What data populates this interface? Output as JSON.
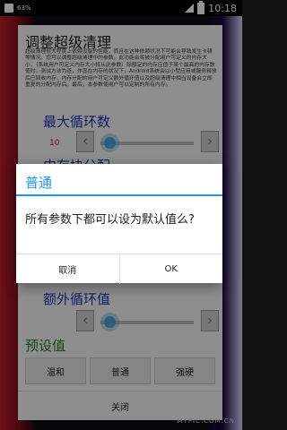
{
  "status_bar": {
    "battery_pct": "63%",
    "time": "10:18"
  },
  "app": {
    "title": "调整超级清理",
    "description": "超级清理很大程度上依赖设备的性能，而且在这种依赖状况下可能会导致发生卡顿等情况。您可以调整超级清理中的参数，此功能会将被分配用户可定义的内存大小，（系统用户可定义内存大小将从此参数）除额定的内存应值于某个最高的内存数值时，测试方法为逐，作显在内存的状况下，Android系统会以小型应用或服务释放后已回收内存，内存分配的用户可定义额外循环值以及超级清理中相当设备会立即重复的分配内存后。最后，本参数使用户可以定制的所有内存。",
    "sections": {
      "max_loop": {
        "title": "最大循环数",
        "value": "10"
      },
      "memory_alloc": {
        "title": "内存块分配"
      },
      "extra_loop": {
        "title": "额外循环值"
      },
      "presets": {
        "title": "预设值"
      }
    },
    "preset_buttons": [
      "温和",
      "普通",
      "强硬"
    ],
    "close_label": "关闭"
  },
  "dialog": {
    "title": "普通",
    "message": "所有参数下都可以设为默认值么?",
    "cancel": "取消",
    "ok": "OK"
  },
  "watermark": "MYPIC.COM.CN",
  "colors": {
    "accent": "#2196f3",
    "section_blue": "#1b2fb3",
    "section_green": "#1e7a1e",
    "value_red": "#b31c1c"
  },
  "sliders": {
    "max_loop_level": 0.05,
    "extra_loop_level": 0.05
  }
}
